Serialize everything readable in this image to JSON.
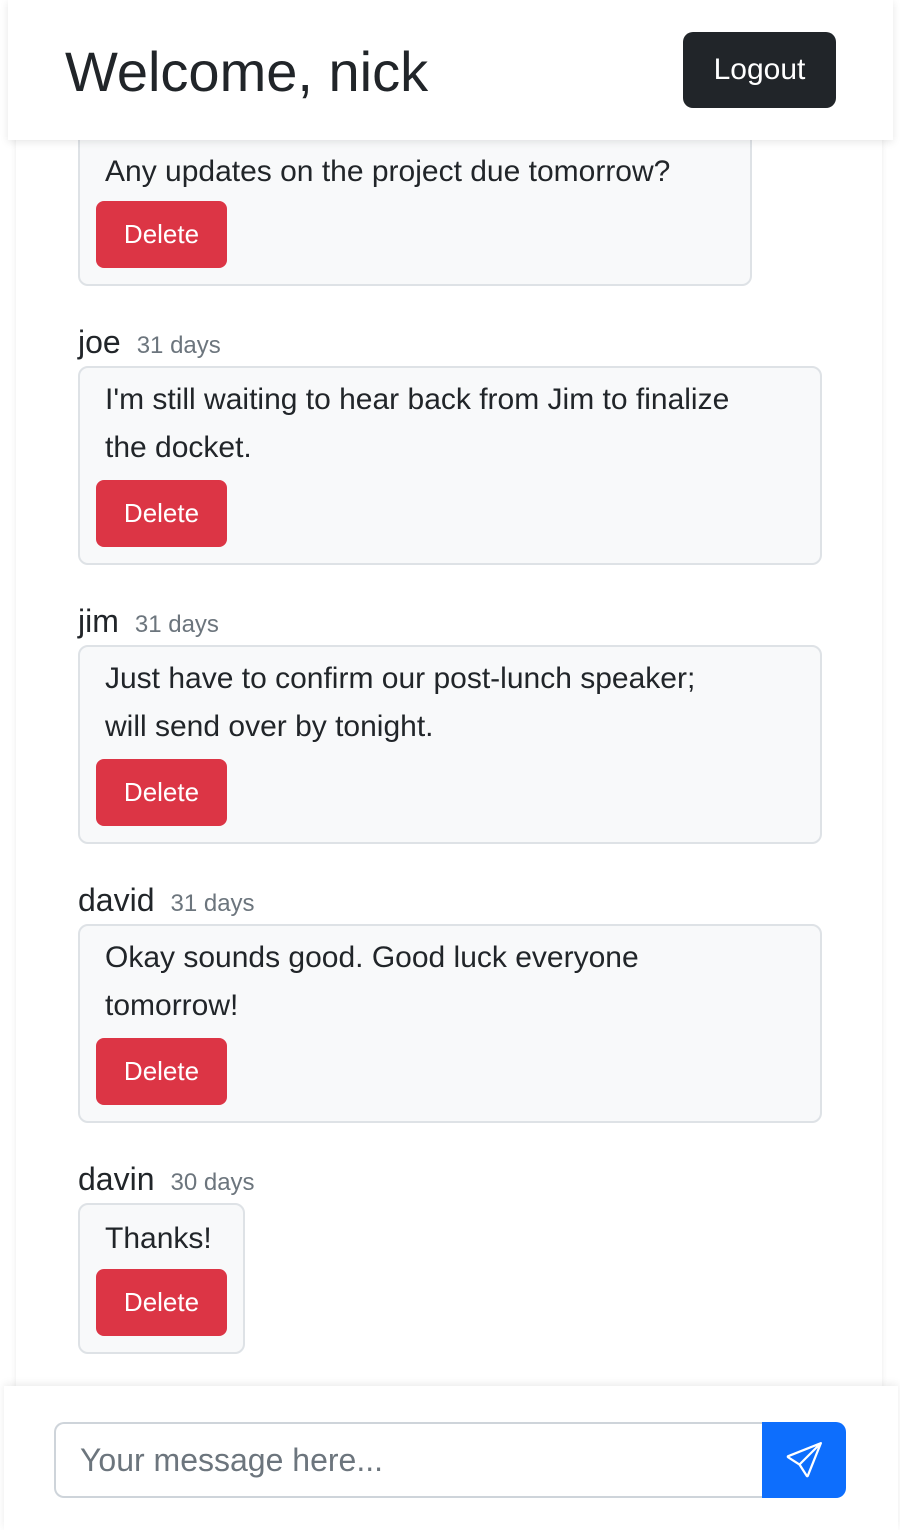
{
  "header": {
    "title": "Welcome, nick",
    "logout_label": "Logout"
  },
  "messages": [
    {
      "author": "",
      "time": "",
      "text_lines": [
        "Any updates on the project due tomorrow?"
      ],
      "delete_label": "Delete"
    },
    {
      "author": "joe",
      "time": "31 days",
      "text_lines": [
        "I'm still waiting to hear back from Jim to finalize",
        "the docket."
      ],
      "delete_label": "Delete"
    },
    {
      "author": "jim",
      "time": "31 days",
      "text_lines": [
        "Just have to confirm our post-lunch speaker;",
        "will send over by tonight."
      ],
      "delete_label": "Delete"
    },
    {
      "author": "david",
      "time": "31 days",
      "text_lines": [
        "Okay sounds good. Good luck everyone",
        "tomorrow!"
      ],
      "delete_label": "Delete"
    },
    {
      "author": "davin",
      "time": "30 days",
      "text_lines": [
        "Thanks!"
      ],
      "delete_label": "Delete"
    }
  ],
  "composer": {
    "placeholder": "Your message here...",
    "send_icon": "send-icon"
  },
  "colors": {
    "danger": "#dc3545",
    "primary": "#0d6efd",
    "dark": "#212529",
    "muted": "#6c757d"
  }
}
